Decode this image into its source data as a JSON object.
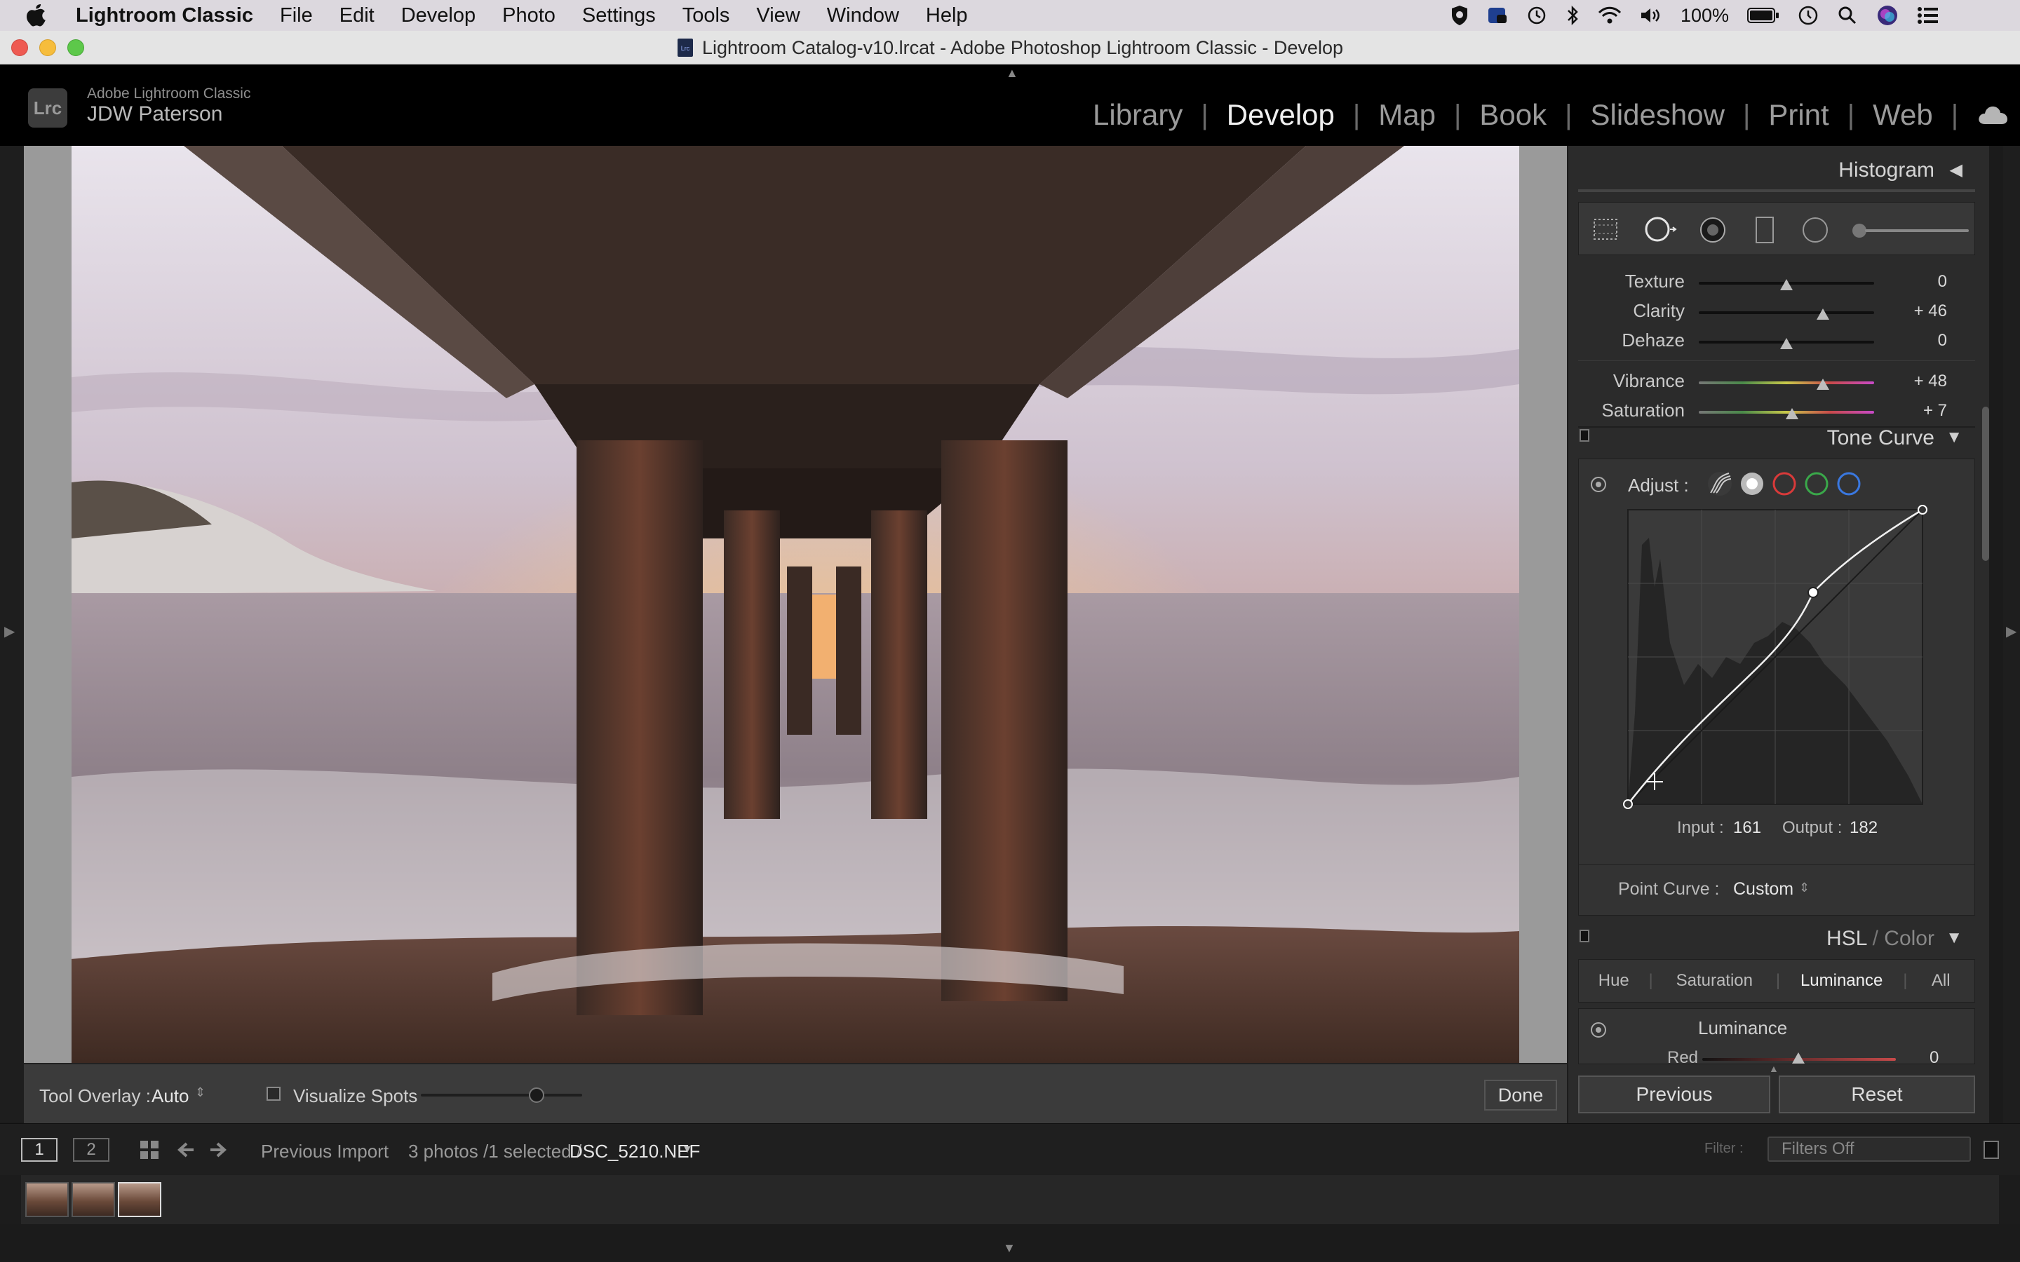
{
  "menubar": {
    "app": "Lightroom Classic",
    "items": [
      "File",
      "Edit",
      "Develop",
      "Photo",
      "Settings",
      "Tools",
      "View",
      "Window",
      "Help"
    ],
    "battery": "100%"
  },
  "window": {
    "title": "Lightroom Catalog-v10.lrcat - Adobe Photoshop Lightroom Classic - Develop"
  },
  "identity": {
    "logo": "Lrc",
    "product": "Adobe Lightroom Classic",
    "user": "JDW Paterson"
  },
  "modules": [
    "Library",
    "Develop",
    "Map",
    "Book",
    "Slideshow",
    "Print",
    "Web"
  ],
  "active_module": "Develop",
  "toolbar": {
    "tool_overlay_label": "Tool Overlay :",
    "tool_overlay_value": "Auto",
    "visualize_spots": "Visualize Spots",
    "done": "Done"
  },
  "panel": {
    "histogram": "Histogram",
    "presence": [
      {
        "label": "Texture",
        "value": "0",
        "pos": 0.5
      },
      {
        "label": "Clarity",
        "value": "+ 46",
        "pos": 0.71
      },
      {
        "label": "Dehaze",
        "value": "0",
        "pos": 0.5
      },
      {
        "label": "Vibrance",
        "value": "+ 48",
        "pos": 0.71
      },
      {
        "label": "Saturation",
        "value": "+ 7",
        "pos": 0.53
      }
    ],
    "tone_curve": {
      "title": "Tone Curve",
      "adjust": "Adjust :",
      "input_label": "Input :",
      "input_value": "161",
      "output_label": "Output :",
      "output_value": "182",
      "point_curve_label": "Point Curve :",
      "point_curve_value": "Custom"
    },
    "hsl": {
      "title_a": "HSL",
      "title_sep": " / ",
      "title_b": "Color",
      "tabs": [
        "Hue",
        "Saturation",
        "Luminance",
        "All"
      ],
      "active_tab": "Luminance",
      "section": "Luminance",
      "first_row": "Red",
      "first_value": "0"
    },
    "previous": "Previous",
    "reset": "Reset"
  },
  "filmstrip": {
    "view1": "1",
    "view2": "2",
    "source": "Previous Import",
    "count": "3 photos /1 selected /",
    "filename": "DSC_5210.NEF",
    "filter_label": "Filter :",
    "filters": "Filters Off"
  },
  "colors": {
    "accent_red": "#d93a3a",
    "accent_green": "#3aa84a",
    "accent_blue": "#3a78e0",
    "panel_bg": "#2b2b2b"
  }
}
